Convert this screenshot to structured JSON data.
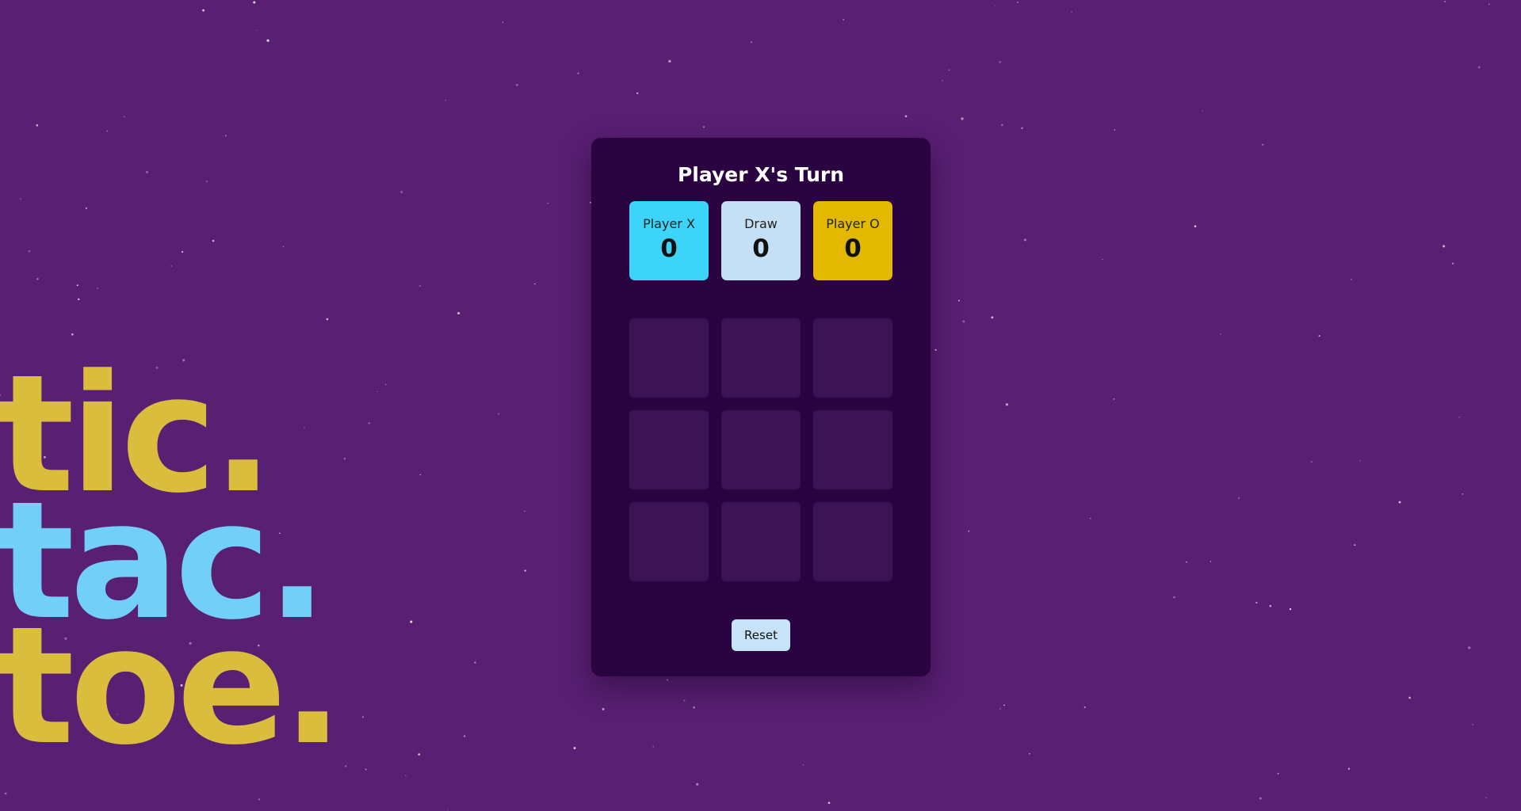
{
  "status": {
    "turn_text": "Player X's Turn"
  },
  "scores": [
    {
      "label": "Player X",
      "value": "0",
      "color": "#3dd4fa"
    },
    {
      "label": "Draw",
      "value": "0",
      "color": "#c5dff5"
    },
    {
      "label": "Player O",
      "value": "0",
      "color": "#e2b800"
    }
  ],
  "board": [
    "",
    "",
    "",
    "",
    "",
    "",
    "",
    "",
    ""
  ],
  "controls": {
    "reset_label": "Reset"
  },
  "background_logo": {
    "lines": [
      {
        "text": "tic.",
        "color": "#dbbd3e"
      },
      {
        "text": "tac.",
        "color": "#72d0f8"
      },
      {
        "text": "toe.",
        "color": "#dbbd3e"
      }
    ]
  },
  "colors": {
    "background": "#591f73",
    "card": "#290440",
    "cell": "#3c1456"
  }
}
